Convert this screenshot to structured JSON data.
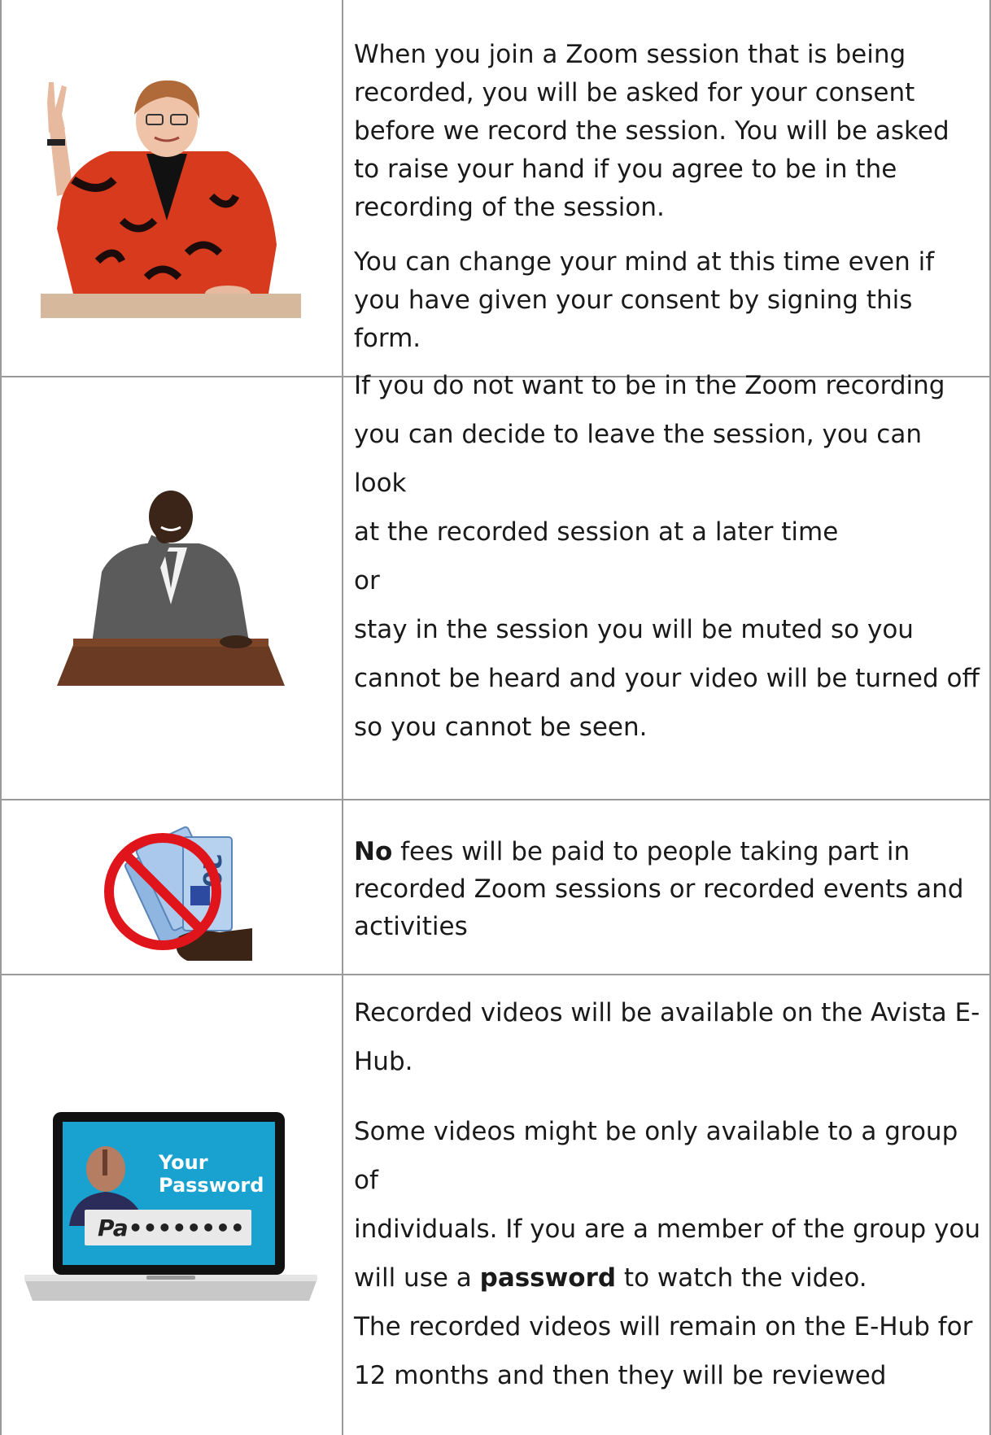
{
  "rows": [
    {
      "image": "woman-raising-hand",
      "paragraphs": [
        "When you join a Zoom session that is being recorded, you will be asked for your consent before we record the session. You will be asked to raise your hand if you agree to be in the recording of the session.",
        "You can change your mind at this time even if you have given your consent by signing this form."
      ]
    },
    {
      "image": "man-thinking-at-desk",
      "lines": [
        "If you do not want to be in the Zoom recording",
        "you can decide to leave the session, you can look",
        "at the recorded session at a later time",
        "or",
        "stay in the session you will be muted so you",
        "cannot be heard and your video will be turned off",
        "so you cannot be seen."
      ]
    },
    {
      "image": "no-money-sign",
      "bold": "No",
      "rest": " fees will be paid to people taking part in recorded Zoom sessions or recorded events and activities",
      "note_text": "20"
    },
    {
      "image": "laptop-password",
      "laptop_title_1": "Your",
      "laptop_title_2": "Password",
      "laptop_field": "Pa••••••••",
      "line1a": "Recorded videos will be available on the Avista  E-",
      "line1b": "Hub.",
      "line2": "Some videos might be only available to a group of",
      "line3": "individuals. If you are a member of the group you",
      "line4_pre": "will use a ",
      "line4_bold": "password",
      "line4_post": " to watch the video.",
      "line5": "The recorded videos will remain on the E-Hub for",
      "line6": "12 months and then they will be reviewed"
    }
  ],
  "colors": {
    "border": "#9a9a9a",
    "sign_red": "#e0141b",
    "money": "#8fb6e0"
  }
}
